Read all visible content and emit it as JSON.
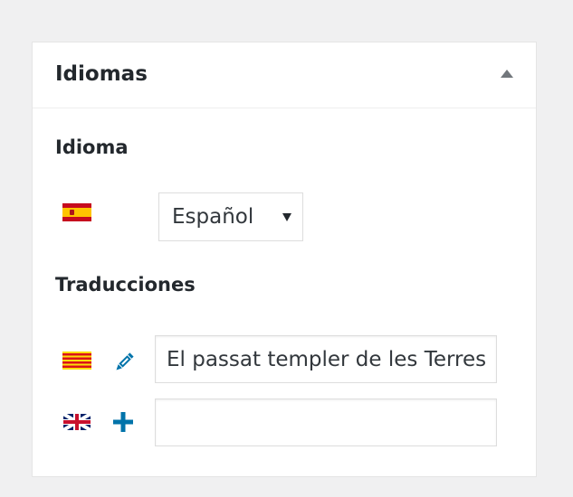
{
  "metabox": {
    "title": "Idiomas",
    "language_section_label": "Idioma",
    "language_select": {
      "value": "Español",
      "flag_icon": "flag-es-icon"
    },
    "translations_section_label": "Traducciones",
    "translations": [
      {
        "flag_icon": "flag-ca-icon",
        "action_icon": "pencil-icon",
        "value": "El passat templer de les Terres de l'Ebre",
        "placeholder": ""
      },
      {
        "flag_icon": "flag-gb-icon",
        "action_icon": "plus-icon",
        "value": "",
        "placeholder": ""
      }
    ]
  },
  "colors": {
    "background": "#f0f0f1",
    "icon_accent": "#0073aa",
    "border": "#dddddd"
  }
}
